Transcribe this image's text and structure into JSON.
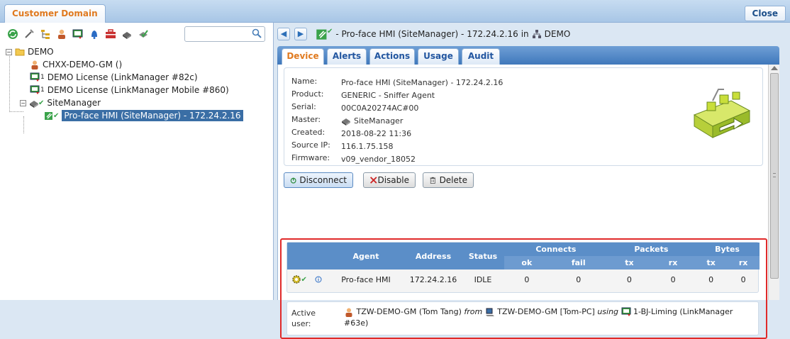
{
  "window": {
    "title": "Customer Domain",
    "close_label": "Close"
  },
  "left": {
    "search_placeholder": "",
    "toolbar_icons": [
      "refresh-icon",
      "tools-icon",
      "hierarchy-icon",
      "user-icon",
      "license-icon",
      "alert-bell-icon",
      "toolbox-icon",
      "device-icon",
      "check-device-icon"
    ],
    "tree": {
      "root": "DEMO",
      "user": "CHXX-DEMO-GM ()",
      "license1": "DEMO License (LinkManager #82c)",
      "license1_sup": "1",
      "license2": "DEMO License (LinkManager Mobile #860)",
      "license2_sup": "1",
      "sitemanager": "SiteManager",
      "agent": "Pro-face HMI (SiteManager) - 172.24.2.16"
    }
  },
  "header": {
    "title": "- Pro-face HMI (SiteManager) - 172.24.2.16",
    "in_word": "in",
    "domain": "DEMO"
  },
  "tabs": [
    "Device",
    "Alerts",
    "Actions",
    "Usage",
    "Audit"
  ],
  "device": {
    "name_label": "Name:",
    "name": "Pro-face HMI (SiteManager) - 172.24.2.16",
    "product_label": "Product:",
    "product": "GENERIC - Sniffer Agent",
    "serial_label": "Serial:",
    "serial": "00C0A20274AC#00",
    "master_label": "Master:",
    "master": "SiteManager",
    "created_label": "Created:",
    "created": "2018-08-22 11:36",
    "source_ip_label": "Source IP:",
    "source_ip": "116.1.75.158",
    "firmware_label": "Firmware:",
    "firmware": "v09_vendor_18052"
  },
  "actions": {
    "disconnect": "Disconnect",
    "disable": "Disable",
    "delete": "Delete"
  },
  "agent_table": {
    "headers": {
      "agent": "Agent",
      "address": "Address",
      "status": "Status",
      "connects": "Connects",
      "packets": "Packets",
      "bytes": "Bytes",
      "ok": "ok",
      "fail": "fail",
      "tx": "tx",
      "rx": "rx"
    },
    "row": {
      "agent": "Pro-face HMI",
      "address": "172.24.2.16",
      "status": "IDLE",
      "connects_ok": "0",
      "connects_fail": "0",
      "packets_tx": "0",
      "packets_rx": "0",
      "bytes_tx": "0",
      "bytes_rx": "0"
    }
  },
  "active_user": {
    "label": "Active user:",
    "user": "TZW-DEMO-GM (Tom Tang)",
    "from": "from",
    "computer": "TZW-DEMO-GM [Tom-PC]",
    "using": "using",
    "license": "1-BJ-Liming (LinkManager #63e)"
  },
  "colors": {
    "accent_orange": "#e07a1f",
    "tab_blue": "#3f78bb",
    "highlight_red": "#e02a2a",
    "selection": "#3a6ea5"
  }
}
